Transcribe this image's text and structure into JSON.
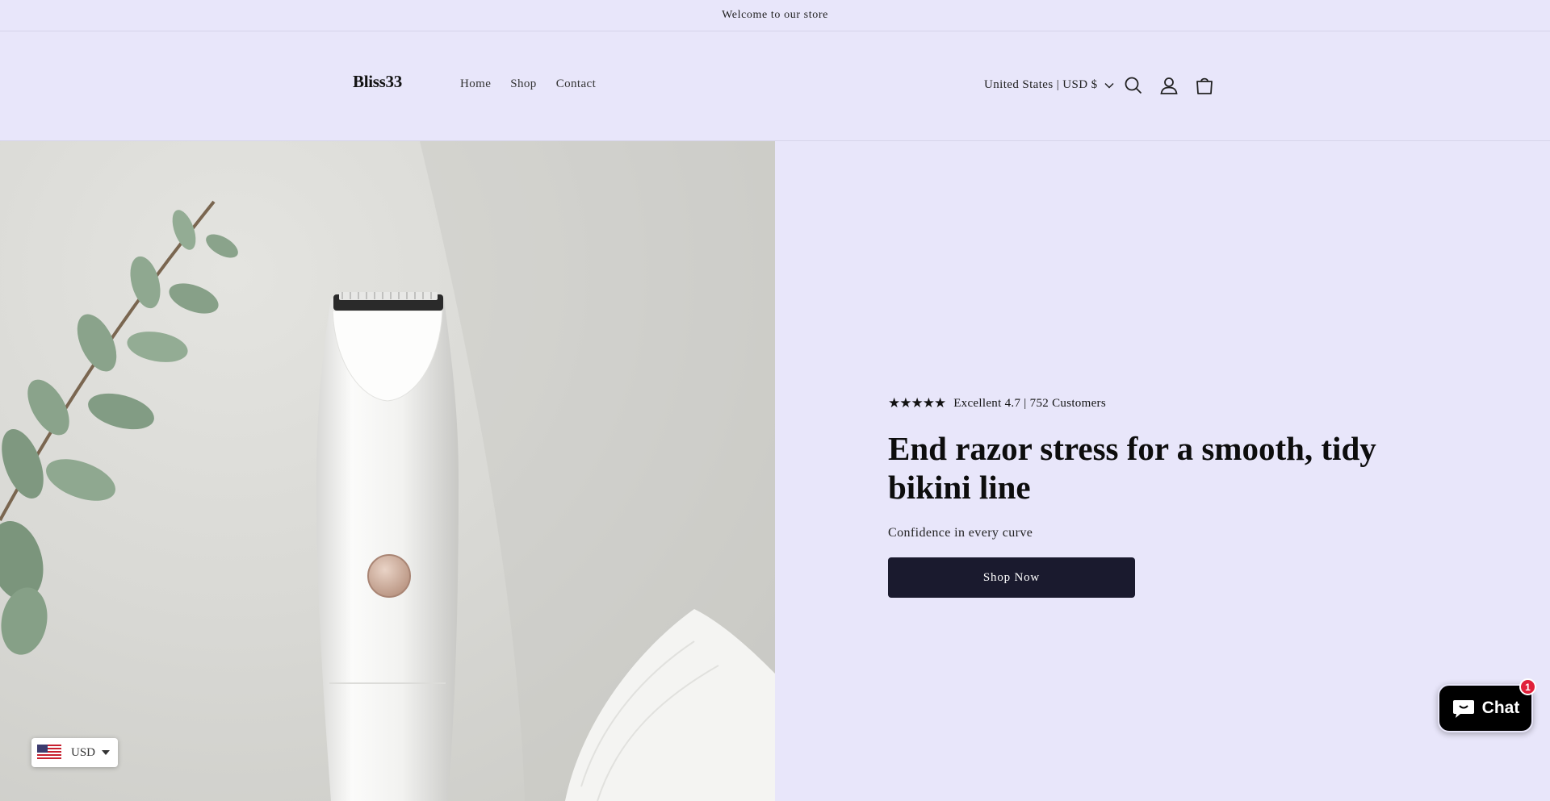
{
  "announcement": {
    "text": "Welcome to our store"
  },
  "header": {
    "logo": "Bliss33",
    "nav": [
      "Home",
      "Shop",
      "Contact"
    ],
    "locale": "United States | USD $",
    "icons": [
      "search-icon",
      "account-icon",
      "cart-icon"
    ]
  },
  "hero": {
    "image_subject": "electric bikini trimmer with eucalyptus sprig and cotton pads",
    "stars": "★★★★★",
    "rating_value": 4.7,
    "rating_text": "Excellent 4.7 | 752 Customers",
    "headline": "End razor stress for a smooth, tidy bikini line",
    "subtext": "Confidence in every curve",
    "cta": "Shop Now"
  },
  "currency_widget": {
    "code": "USD",
    "flag": "us-flag-icon"
  },
  "chat": {
    "label": "Chat",
    "badge": "1"
  },
  "colors": {
    "background": "#e8e6fa",
    "button": "#1a1a2e",
    "chat": "#000000",
    "badge": "#e0203a"
  }
}
